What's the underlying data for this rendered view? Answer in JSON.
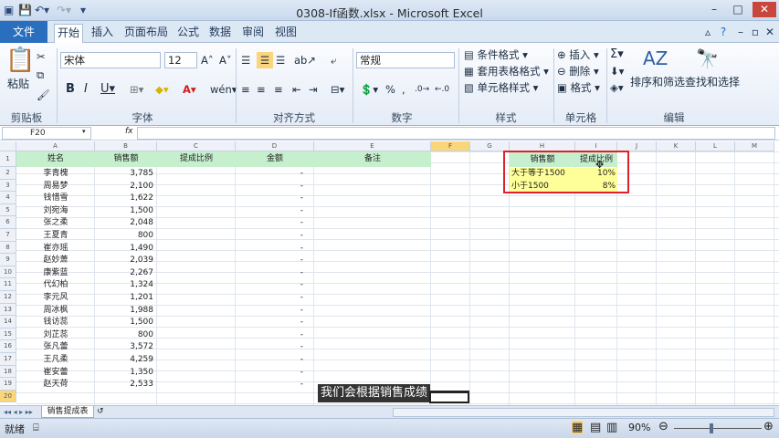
{
  "window": {
    "title": "0308-If函数.xlsx - Microsoft Excel"
  },
  "tabs": [
    "文件",
    "开始",
    "插入",
    "页面布局",
    "公式",
    "数据",
    "审阅",
    "视图"
  ],
  "ribbon": {
    "clipboard": {
      "paste": "粘贴",
      "label": "剪贴板"
    },
    "font": {
      "name": "宋体",
      "size": "12",
      "label": "字体"
    },
    "alignment": {
      "label": "对齐方式"
    },
    "number": {
      "format": "常规",
      "label": "数字"
    },
    "styles": {
      "cond": "条件格式",
      "table": "套用表格格式",
      "cell": "单元格样式",
      "label": "样式"
    },
    "cells": {
      "insert": "插入",
      "delete": "删除",
      "format": "格式",
      "label": "单元格"
    },
    "editing": {
      "sort": "排序和筛选",
      "find": "查找和选择",
      "label": "编辑"
    }
  },
  "formula_bar": {
    "name_box": "F20",
    "fx": "fx"
  },
  "columns": [
    "A",
    "B",
    "C",
    "D",
    "E",
    "F",
    "G",
    "H",
    "I",
    "J",
    "K",
    "L",
    "M"
  ],
  "rows": [
    "1",
    "2",
    "3",
    "4",
    "5",
    "6",
    "7",
    "8",
    "9",
    "10",
    "11",
    "12",
    "13",
    "14",
    "15",
    "16",
    "17",
    "18",
    "19",
    "20"
  ],
  "table": {
    "headers": [
      "姓名",
      "销售额",
      "提成比例",
      "金额",
      "备注"
    ],
    "records": [
      {
        "name": "李青槐",
        "sales": "3,785",
        "amount": "-"
      },
      {
        "name": "周易梦",
        "sales": "2,100",
        "amount": "-"
      },
      {
        "name": "钱惜雪",
        "sales": "1,622",
        "amount": "-"
      },
      {
        "name": "刘宛海",
        "sales": "1,500",
        "amount": "-"
      },
      {
        "name": "张之柔",
        "sales": "2,048",
        "amount": "-"
      },
      {
        "name": "王夏青",
        "sales": "800",
        "amount": "-"
      },
      {
        "name": "崔亦瑶",
        "sales": "1,490",
        "amount": "-"
      },
      {
        "name": "赵妙萧",
        "sales": "2,039",
        "amount": "-"
      },
      {
        "name": "康紫蓝",
        "sales": "2,267",
        "amount": "-"
      },
      {
        "name": "代幻柏",
        "sales": "1,324",
        "amount": "-"
      },
      {
        "name": "李元风",
        "sales": "1,201",
        "amount": "-"
      },
      {
        "name": "周冰枫",
        "sales": "1,988",
        "amount": "-"
      },
      {
        "name": "钱访蕊",
        "sales": "1,500",
        "amount": "-"
      },
      {
        "name": "刘芷蕊",
        "sales": "800",
        "amount": "-"
      },
      {
        "name": "张凡蕾",
        "sales": "3,572",
        "amount": "-"
      },
      {
        "name": "王凡柔",
        "sales": "4,259",
        "amount": "-"
      },
      {
        "name": "崔安蕾",
        "sales": "1,350",
        "amount": "-"
      },
      {
        "name": "赵天荷",
        "sales": "2,533",
        "amount": "-"
      }
    ]
  },
  "lookup": {
    "headers": [
      "销售额",
      "提成比例"
    ],
    "rows": [
      {
        "cond": "大于等于1500",
        "rate": "10%"
      },
      {
        "cond": "小于1500",
        "rate": "8%"
      }
    ]
  },
  "sheet_tab": "销售提成表",
  "status": {
    "ready": "就绪",
    "zoom": "90%"
  },
  "subtitle": "我们会根据销售成绩",
  "colors": {
    "header_green": "#c6efce",
    "lookup_yellow": "#ffff99",
    "highlight_red": "#e0202a",
    "file_tab": "#2a6fbd"
  }
}
